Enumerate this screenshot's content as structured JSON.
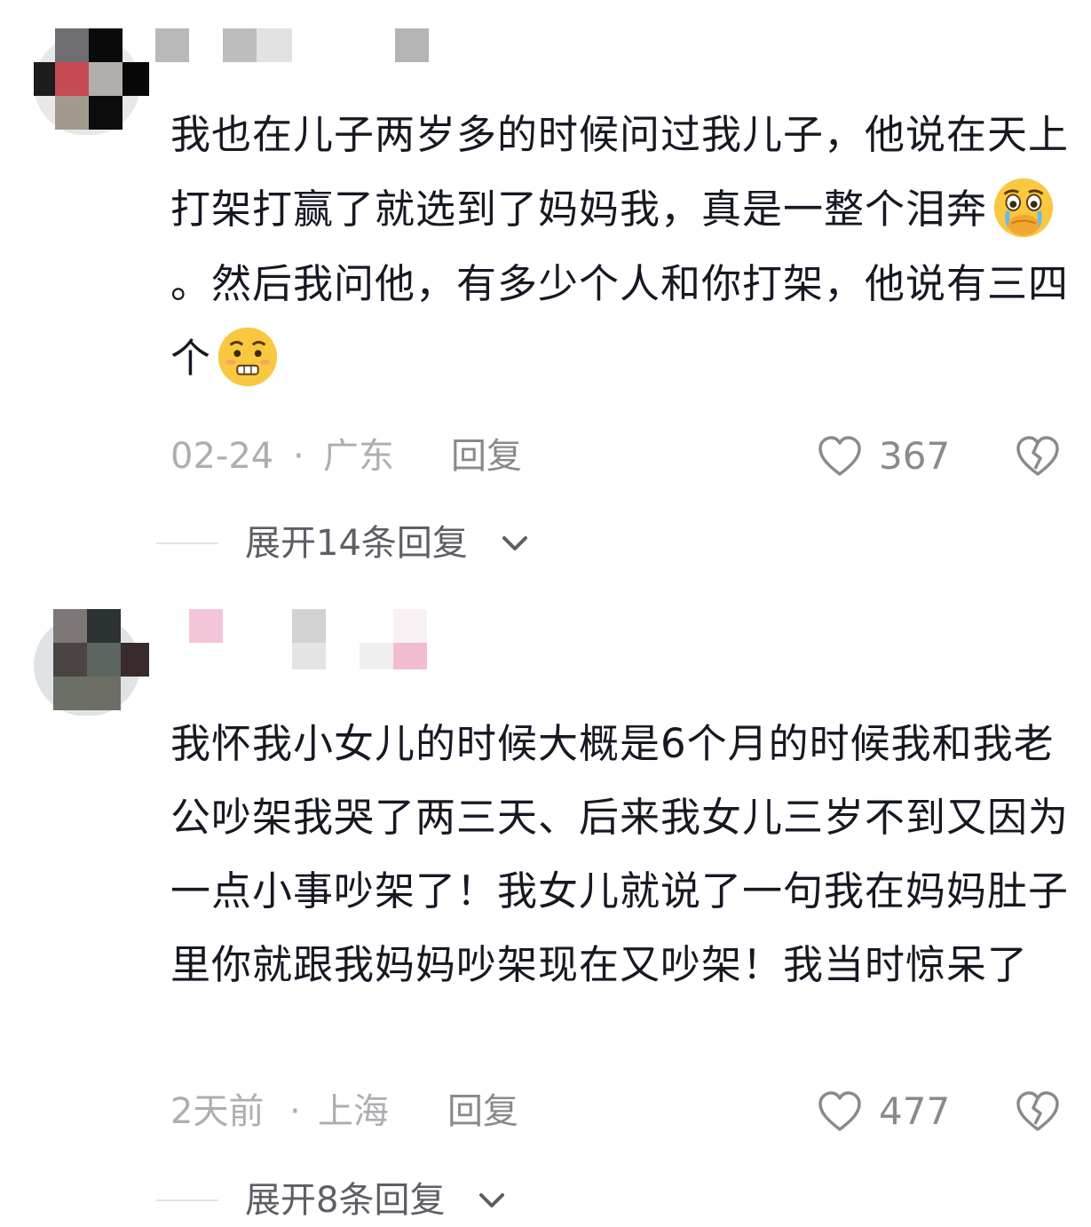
{
  "comments": [
    {
      "text_before_emoji1": "我也在儿子两岁多的时候问过我儿子，他说在天上打架打赢了就选到了妈妈我，真是一整个泪奔",
      "text_between": "。然后我问他，有多少个人和你打架，他说有三四个",
      "emoji1": "teary-face-emoji",
      "emoji2": "grimace-face-emoji",
      "time": "02-24",
      "separator": "·",
      "location": "广东",
      "reply_label": "回复",
      "like_count": "367",
      "expand_label": "展开14条回复"
    },
    {
      "text": "我怀我小女儿的时候大概是6个月的时候我和我老公吵架我哭了两三天、后来我女儿三岁不到又因为一点小事吵架了！我女儿就说了一句我在妈妈肚子里你就跟我妈妈吵架现在又吵架！我当时惊呆了",
      "time": "2天前",
      "separator": "·",
      "location": "上海",
      "reply_label": "回复",
      "like_count": "477",
      "expand_label": "展开8条回复"
    }
  ],
  "icons": {
    "like": "heart-outline-icon",
    "dislike": "broken-heart-icon",
    "expand": "chevron-down-icon"
  },
  "colors": {
    "text": "#161823",
    "meta": "#aeaeb2",
    "reply": "#8a8a8e",
    "expand": "#5e5e66"
  }
}
